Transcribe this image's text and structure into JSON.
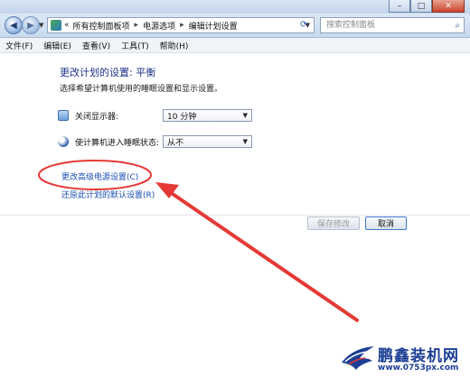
{
  "window": {
    "controls": {
      "minimize": "–",
      "maximize": "□",
      "close": "✕"
    }
  },
  "address_bar": {
    "back_icon": "back-arrow",
    "forward_icon": "forward-arrow",
    "prefix": "«",
    "breadcrumbs": [
      "所有控制面板项",
      "电源选项",
      "编辑计划设置"
    ],
    "separator": "▸",
    "dropdown_icon": "chevron-down",
    "refresh_icon": "refresh"
  },
  "search": {
    "placeholder": "搜索控制面板",
    "icon": "magnifier"
  },
  "menu": {
    "items": [
      "文件(F)",
      "编辑(E)",
      "查看(V)",
      "工具(T)",
      "帮助(H)"
    ]
  },
  "main": {
    "title": "更改计划的设置: 平衡",
    "subtitle": "选择希望计算机使用的睡眠设置和显示设置。",
    "settings": [
      {
        "label": "关闭显示器:",
        "value": "10 分钟",
        "icon": "monitor-icon"
      },
      {
        "label": "使计算机进入睡眠状态:",
        "value": "从不",
        "icon": "sleep-moon-icon"
      }
    ],
    "links": {
      "advanced": "更改高级电源设置(C)",
      "restore": "还原此计划的默认设置(R)"
    },
    "buttons": {
      "save": "保存修改",
      "cancel": "取消"
    }
  },
  "annotation": {
    "highlight_color": "#e53935"
  },
  "watermark": {
    "name": "鹏鑫装机网",
    "url": "www.0753px.com"
  },
  "colors": {
    "title_text": "#1e3287",
    "link": "#1b4fb5",
    "accent_red": "#e53935",
    "brand_blue": "#1c3f94"
  }
}
